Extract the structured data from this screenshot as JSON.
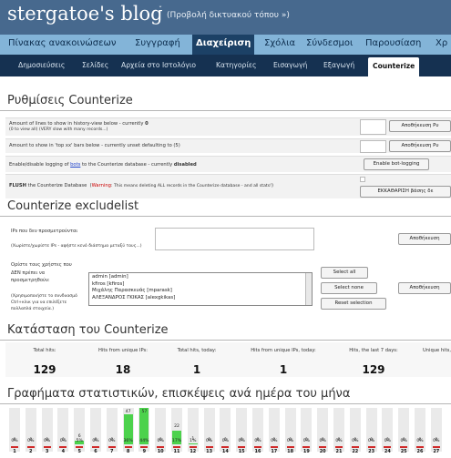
{
  "header": {
    "title": "stergatoe's blog",
    "arrow": "ˇ",
    "view_link": "(Προβολή δικτυακού τόπου »)"
  },
  "main_menu": [
    "Πίνακας ανακοινώσεων",
    "Συγγραφή",
    "Διαχείριση",
    "Σχόλια",
    "Σύνδεσμοι",
    "Παρουσίαση",
    "Χρ"
  ],
  "sub_menu": [
    "Δημοσιεύσεις",
    "Σελίδες",
    "Αρχεία στο Ιστολόγιο",
    "Κατηγορίες",
    "Εισαγωγή",
    "Εξαγωγή",
    "Counterize"
  ],
  "settings": {
    "heading": "Ρυθμίσεις Counterize",
    "row1_label": "Amount of lines to show in history-view below - currently",
    "row1_value": "0",
    "row1_sub": "(0 to view all) (VERY slow with many records...)",
    "row1_button": "Αποθήκευση Ρυ",
    "row2_label": "Amount to show in 'top xx' bars below - currently unset defaulting to (5)",
    "row2_button": "Αποθήκευση Ρυ",
    "row3_label": "Enable/disable logging of",
    "row3_link": "bots",
    "row3_label2": "to the Counterize database - currently",
    "row3_value": "disabled",
    "row3_button": "Enable bot-logging",
    "row4_label_bold": "FLUSH",
    "row4_label": "the Counterize Database",
    "row4_warning_word": "Warning",
    "row4_warning": ": This means deleting ALL records in the Counterize database - and all stats!",
    "row4_close": ")",
    "row4_button": "ΕΚΚΑΘΑΡΙΣΗ βάσης δε"
  },
  "exclude": {
    "heading": "Counterize excludelist",
    "ips_label": "IPs που δεν προσμετρούνται",
    "ips_hint": "(Χωρίστε/χωρίστε IPs - αφήστε κενό διάστημα μεταξύ τους...)",
    "ips_button": "Αποθήκευση",
    "users_label": "Ορίστε τους χρήστες που ΔΕΝ πρέπει να προσμετρηθούν:",
    "users_hint": "(Χρησιμοποιήστε το συνδυασμό Ctrl+κλικ για να επιλέξετε πολλαπλά στοιχεία.)",
    "users": [
      "admin   [admin]",
      "kfiros   [kfiros]",
      "Μιχάλης Παρασκευάς   [mparask]",
      "ΑΛΕΞΑΝΔΡΟΣ ΓΚΙΚΑΣ   [alexgkikas]"
    ],
    "select_all": "Select all",
    "select_none": "Select none",
    "reset_selection": "Reset selection",
    "users_button": "Αποθήκευση"
  },
  "status": {
    "heading": "Κατάσταση του Counterize",
    "items": [
      {
        "label": "Total hits:",
        "value": "129"
      },
      {
        "label": "Hits from unique IPs:",
        "value": "18"
      },
      {
        "label": "Total hits, today:",
        "value": "1"
      },
      {
        "label": "Hits from unique IPs, today:",
        "value": "1"
      },
      {
        "label": "Hits, the last 7 days:",
        "value": "129"
      },
      {
        "label": "Unique hits,",
        "value": ""
      }
    ]
  },
  "graphs": {
    "heading": "Γραφήματα στατιστικών, επισκέψεις ανά ημέρα του μήνα"
  },
  "chart_data": {
    "type": "bar",
    "categories": [
      "1",
      "2",
      "3",
      "4",
      "5",
      "6",
      "7",
      "8",
      "9",
      "10",
      "11",
      "12",
      "13",
      "14",
      "15",
      "16",
      "17",
      "18",
      "19",
      "20",
      "21",
      "22",
      "23",
      "24",
      "25",
      "26",
      "27"
    ],
    "values": [
      0,
      0,
      0,
      0,
      6,
      0,
      0,
      47,
      57,
      0,
      22,
      1,
      0,
      0,
      0,
      0,
      0,
      0,
      0,
      0,
      0,
      0,
      0,
      0,
      0,
      0,
      0
    ],
    "percents": [
      "0%",
      "0%",
      "0%",
      "0%",
      "5%",
      "0%",
      "0%",
      "36%",
      "44%",
      "0%",
      "17%",
      "1%",
      "0%",
      "0%",
      "0%",
      "0%",
      "0%",
      "0%",
      "0%",
      "0%",
      "0%",
      "0%",
      "0%",
      "0%",
      "0%",
      "0%",
      "0%"
    ],
    "ylim": [
      0,
      57
    ],
    "bar_color": "#4cd24c"
  }
}
